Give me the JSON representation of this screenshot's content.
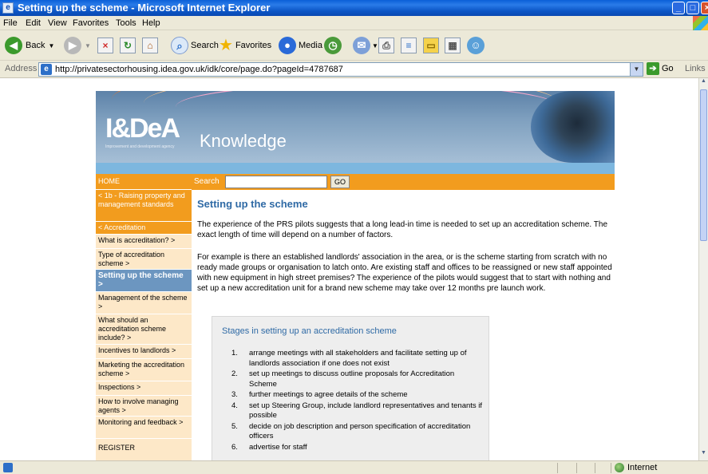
{
  "window": {
    "title": "Setting up the scheme - Microsoft Internet Explorer",
    "min_label": "_",
    "max_label": "□",
    "close_label": "×"
  },
  "menu": [
    "File",
    "Edit",
    "View",
    "Favorites",
    "Tools",
    "Help"
  ],
  "toolbar": {
    "back": "Back",
    "search": "Search",
    "favorites": "Favorites",
    "media": "Media"
  },
  "address": {
    "label": "Address",
    "url": "http://privatesectorhousing.idea.gov.uk/idk/core/page.do?pageId=4787687",
    "go": "Go",
    "links": "Links"
  },
  "banner": {
    "logo": "I&DeA",
    "logo_sub": "Improvement and development agency",
    "title": "Knowledge"
  },
  "search": {
    "label": "Search",
    "placeholder": "",
    "go": "GO"
  },
  "nav": {
    "home": "HOME",
    "items": [
      "< 1b - Raising property and management standards",
      "< Accreditation",
      "What is accreditation? >",
      "Type of accreditation scheme >",
      "Setting up the scheme >",
      "Management of the scheme >",
      "What should an accreditation scheme include? >",
      "Incentives to landlords >",
      "Marketing the accreditation scheme >",
      "Inspections >",
      "How to involve managing agents >",
      "Monitoring and feedback >",
      "REGISTER"
    ]
  },
  "content": {
    "heading": "Setting up the scheme",
    "para1": "The experience of the PRS pilots suggests that a long lead-in time is needed to set up an accreditation scheme. The exact length of time will depend on a number of factors.",
    "para2": "For example is there an established landlords' association in the area, or is the scheme starting from scratch with no ready made groups or organisation to latch onto. Are existing staff and offices to be reassigned or new staff appointed with new equipment in high street premises? The experience of the pilots would suggest that to start with nothing and set up a new accreditation unit for a brand new scheme may take over 12 months pre launch work.",
    "stages_title": "Stages in setting up an accreditation scheme",
    "stages": [
      {
        "num": "1.",
        "text": "arrange meetings with all stakeholders and facilitate setting up of landlords association if one does not exist"
      },
      {
        "num": "2.",
        "text": "set up meetings to discuss outline proposals for Accreditation Scheme"
      },
      {
        "num": "3.",
        "text": "further meetings to agree details of the scheme"
      },
      {
        "num": "4.",
        "text": "set up Steering Group, include landlord representatives and tenants if possible"
      },
      {
        "num": "5.",
        "text": "decide on job description and person specification of accreditation officers"
      },
      {
        "num": "6.",
        "text": "advertise for staff"
      }
    ]
  },
  "status": {
    "zone": "Internet"
  },
  "colors": {
    "accent_orange": "#f29c1e",
    "heading_blue": "#2f6aa5",
    "active_nav": "#6c96c0"
  }
}
